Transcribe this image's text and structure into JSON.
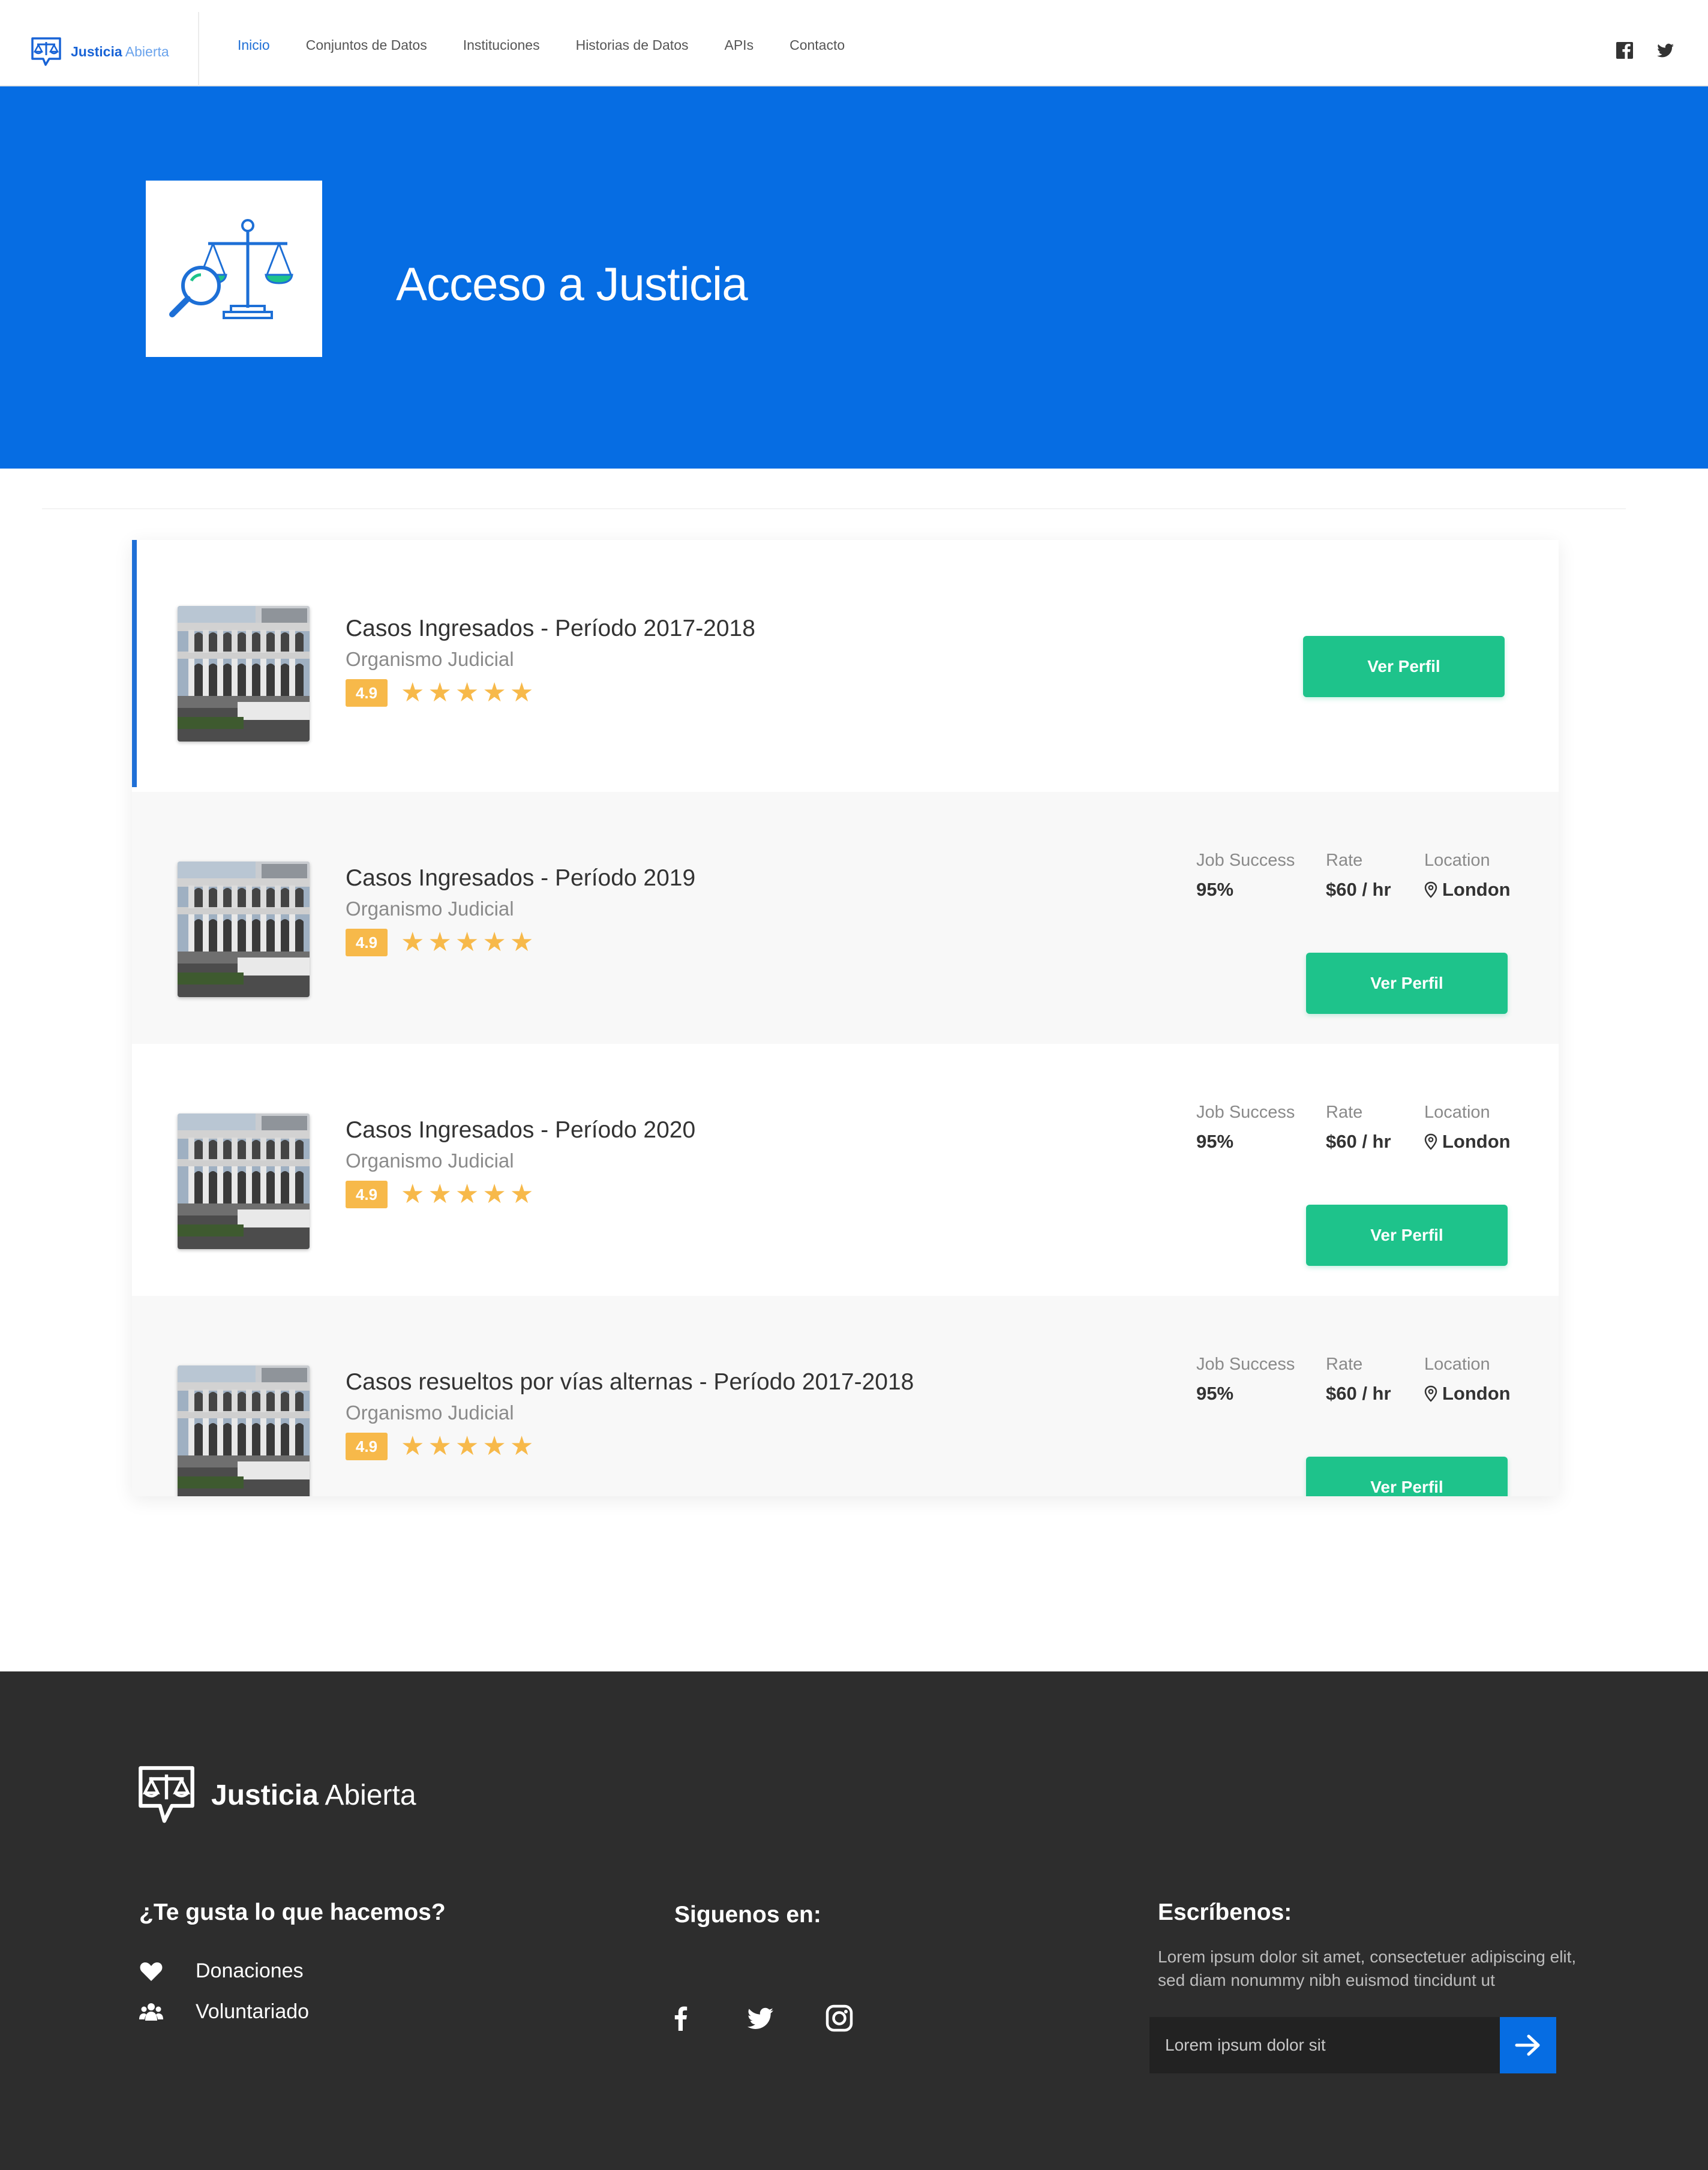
{
  "nav": {
    "brand_bold": "Justicia",
    "brand_light": "Abierta",
    "links": [
      "Inicio",
      "Conjuntos de Datos",
      "Instituciones",
      "Historias de Datos",
      "APIs",
      "Contacto"
    ],
    "active_index": 0,
    "social_icons": [
      "facebook-icon",
      "twitter-icon"
    ]
  },
  "hero": {
    "title": "Acceso a Justicia",
    "icon": "scales-magnifier-icon"
  },
  "items": [
    {
      "title": "Casos Ingresados - Período 2017-2018",
      "subtitle": "Organismo Judicial",
      "rating": "4.9",
      "stars": 5,
      "button": "Ver Perfil",
      "has_stats": false
    },
    {
      "title": "Casos Ingresados - Período 2019",
      "subtitle": "Organismo Judicial",
      "rating": "4.9",
      "stars": 5,
      "button": "Ver Perfil",
      "has_stats": true,
      "stats": {
        "job_success_label": "Job Success",
        "job_success_value": "95%",
        "rate_label": "Rate",
        "rate_value": "$60 / hr",
        "location_label": "Location",
        "location_value": "London"
      }
    },
    {
      "title": "Casos Ingresados - Período 2020",
      "subtitle": "Organismo Judicial",
      "rating": "4.9",
      "stars": 5,
      "button": "Ver Perfil",
      "has_stats": true,
      "stats": {
        "job_success_label": "Job Success",
        "job_success_value": "95%",
        "rate_label": "Rate",
        "rate_value": "$60 / hr",
        "location_label": "Location",
        "location_value": "London"
      }
    },
    {
      "title": "Casos resueltos por vías alternas - Período 2017-2018",
      "subtitle": "Organismo Judicial",
      "rating": "4.9",
      "stars": 5,
      "button": "Ver Perfil",
      "has_stats": true,
      "stats": {
        "job_success_label": "Job Success",
        "job_success_value": "95%",
        "rate_label": "Rate",
        "rate_value": "$60 / hr",
        "location_label": "Location",
        "location_value": "London"
      }
    }
  ],
  "footer": {
    "brand_bold": "Justicia",
    "brand_light": "Abierta",
    "col1_title": "¿Te gusta lo que hacemos?",
    "col1_links": [
      {
        "label": "Donaciones",
        "icon": "heart-icon"
      },
      {
        "label": "Voluntariado",
        "icon": "users-icon"
      }
    ],
    "col2_title": "Siguenos en:",
    "col2_social": [
      "facebook-icon",
      "twitter-icon",
      "instagram-icon"
    ],
    "col3_title": "Escríbenos:",
    "col3_text": "Lorem ipsum dolor sit amet, consectetuer adipiscing elit, sed diam nonummy nibh euismod tincidunt ut",
    "subscribe_placeholder": "Lorem ipsum dolor sit",
    "subscribe_icon": "arrow-right-icon"
  },
  "colors": {
    "primary_blue": "#066de3",
    "accent_green": "#1ec38b",
    "star_yellow": "#f7b94a",
    "footer_bg": "#2d2d2d"
  }
}
